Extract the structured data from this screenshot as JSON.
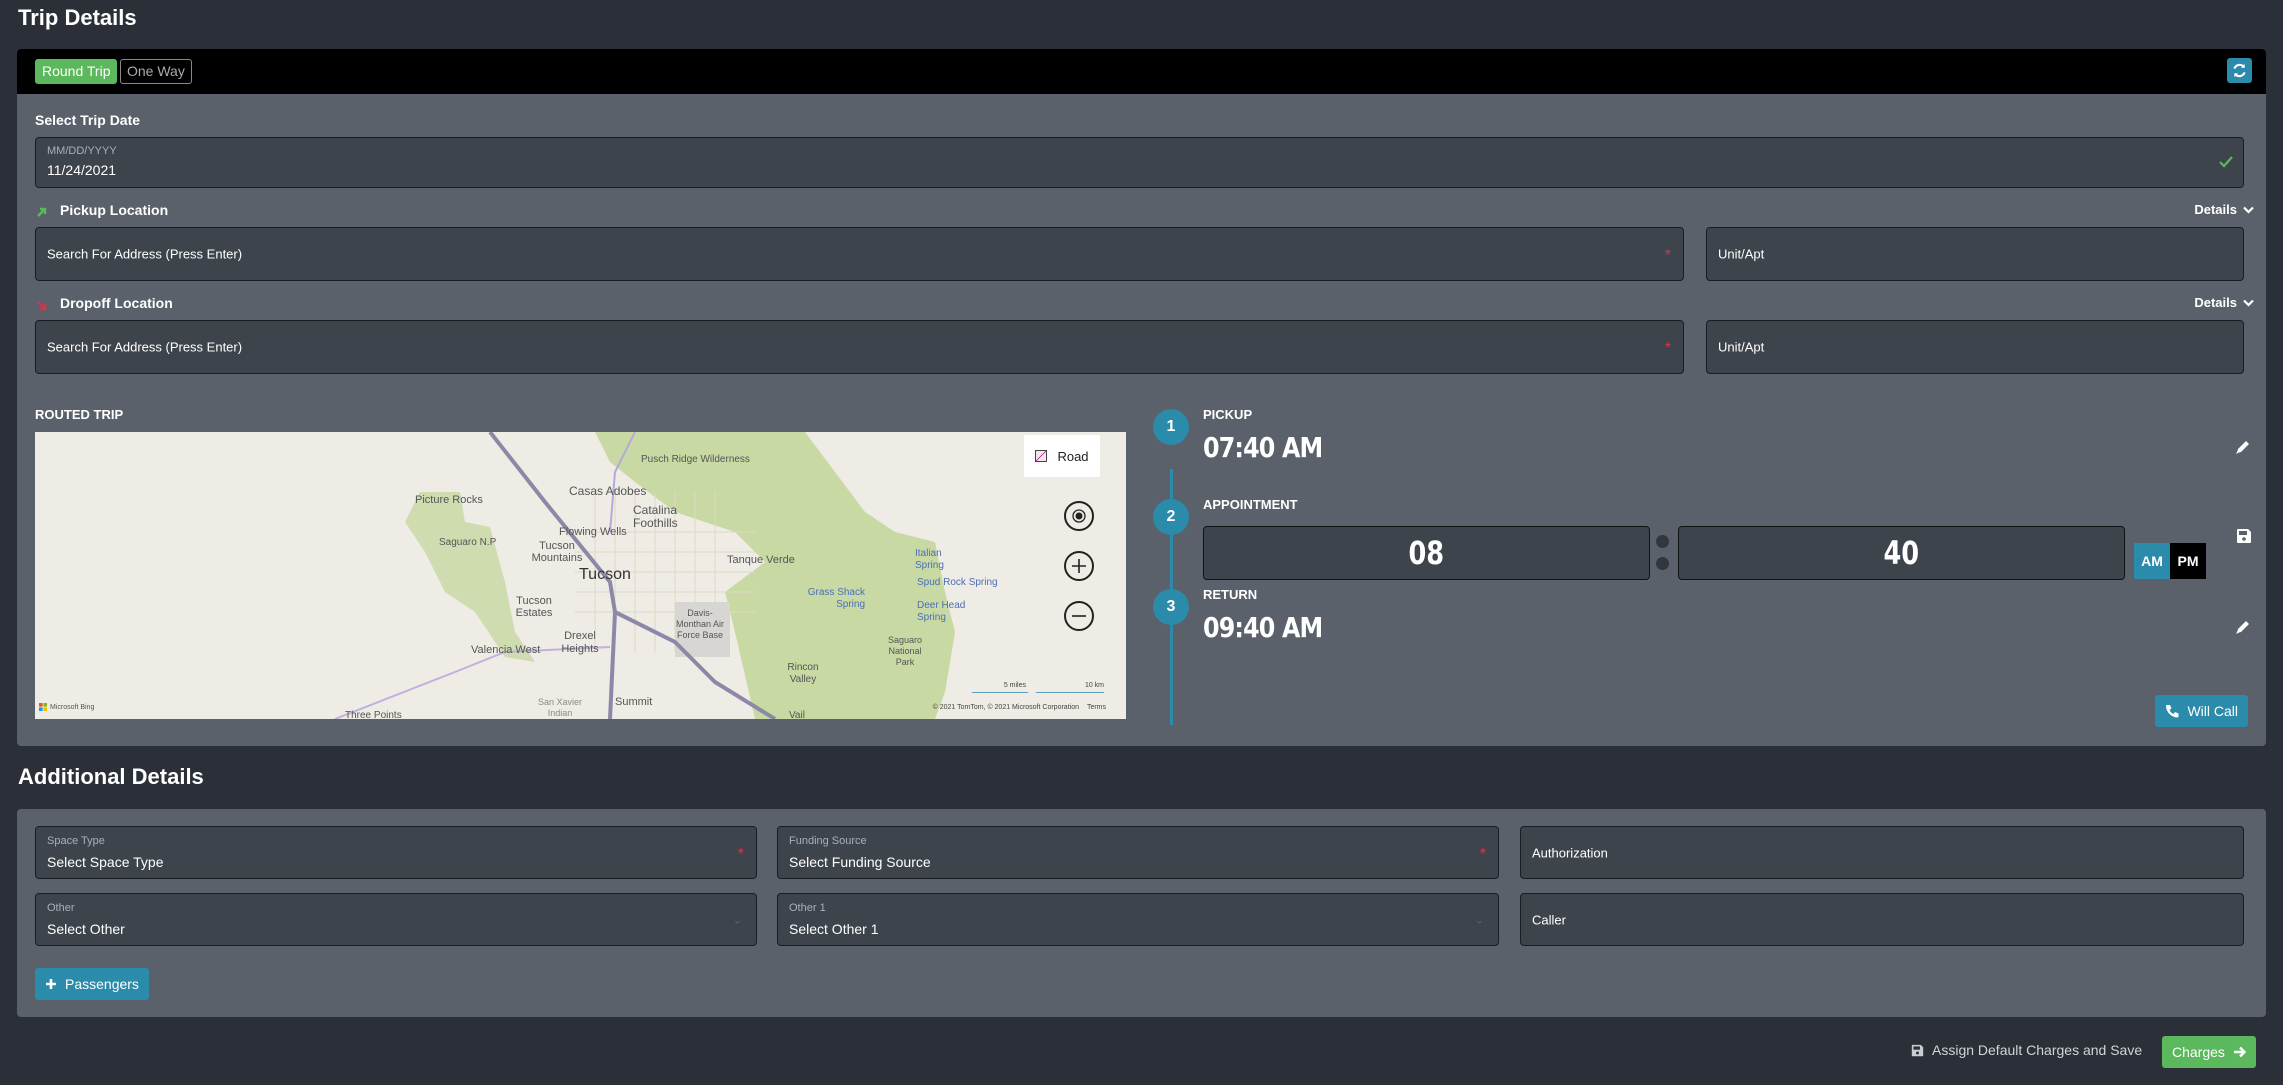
{
  "trip": {
    "title": "Trip Details",
    "trip_types": [
      {
        "label": "Round Trip",
        "active": true
      },
      {
        "label": "One Way",
        "active": false
      }
    ],
    "refresh_icon": "refresh-icon",
    "date": {
      "label": "Select Trip Date",
      "placeholder": "MM/DD/YYYY",
      "value": "11/24/2021",
      "valid_icon": "check-icon"
    },
    "pickup": {
      "label": "Pickup Location",
      "icon": "arrow-up-right-icon",
      "details_label": "Details",
      "address_placeholder": "Search For Address (Press Enter)",
      "unit_placeholder": "Unit/Apt",
      "required": "*"
    },
    "dropoff": {
      "label": "Dropoff Location",
      "icon": "arrow-down-right-icon",
      "details_label": "Details",
      "address_placeholder": "Search For Address (Press Enter)",
      "unit_placeholder": "Unit/Apt",
      "required": "*"
    },
    "map": {
      "title": "ROUTED TRIP",
      "map_type_label": "Road",
      "labels": [
        "Pusch Ridge Wilderness",
        "Casas Adobes",
        "Catalina Foothills",
        "Picture Rocks",
        "Saguaro N.P",
        "Flowing Wells",
        "Tucson Mountains",
        "Tucson",
        "Tanque Verde",
        "Italian Spring",
        "Spud Rock Spring",
        "Grass Shack Spring",
        "Deer Head Spring",
        "Tucson Estates",
        "Davis-Monthan Air Force Base",
        "Drexel Heights",
        "Valencia West",
        "Saguaro National Park",
        "Rincon Valley",
        "San Xavier Indian",
        "Summit",
        "Three Points",
        "Vail"
      ],
      "scale_miles": "5 miles",
      "scale_km": "10 km",
      "attribution": "© 2021 TomTom, © 2021 Microsoft Corporation",
      "terms": "Terms",
      "bing": "Microsoft Bing"
    },
    "schedule": {
      "steps": [
        {
          "number": "1",
          "label": "PICKUP",
          "time": "07:40 AM"
        },
        {
          "number": "2",
          "label": "APPOINTMENT",
          "hour": "08",
          "minute": "40",
          "am": "AM",
          "pm": "PM",
          "selected_period": "AM"
        },
        {
          "number": "3",
          "label": "RETURN",
          "time": "09:40 AM"
        }
      ],
      "will_call_label": "Will Call"
    }
  },
  "additional": {
    "title": "Additional Details",
    "fields": {
      "space_type": {
        "label": "Space Type",
        "value": "Select Space Type",
        "required": "*"
      },
      "funding_source": {
        "label": "Funding Source",
        "value": "Select Funding Source",
        "required": "*"
      },
      "authorization": {
        "placeholder": "Authorization"
      },
      "other": {
        "label": "Other",
        "value": "Select Other"
      },
      "other1": {
        "label": "Other 1",
        "value": "Select Other 1"
      },
      "caller": {
        "placeholder": "Caller"
      }
    },
    "passengers_label": "Passengers"
  },
  "footer": {
    "assign_label": "Assign Default Charges and Save",
    "charges_label": "Charges"
  },
  "colors": {
    "accent_teal": "#2a8bab",
    "success_green": "#5cb85c",
    "required_red": "#d9334a",
    "page_bg": "#2b3038",
    "panel_bg": "#5a616b",
    "field_bg": "#3e444c"
  }
}
